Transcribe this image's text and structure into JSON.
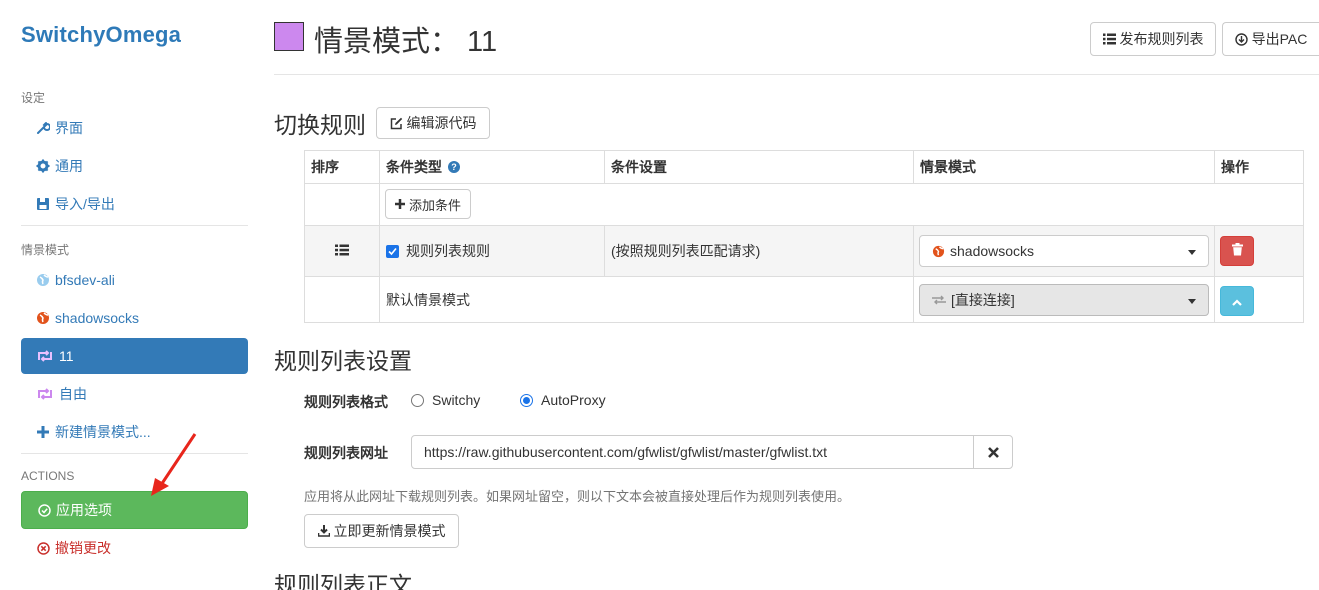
{
  "app": {
    "name": "SwitchyOmega"
  },
  "sidebar": {
    "settings_header": "设定",
    "settings_items": [
      {
        "label": "界面",
        "icon": "wrench-icon"
      },
      {
        "label": "通用",
        "icon": "gear-icon"
      },
      {
        "label": "导入/导出",
        "icon": "floppy-icon"
      }
    ],
    "profiles_header": "情景模式",
    "profiles": [
      {
        "label": "bfsdev-ali",
        "icon": "globe-icon",
        "color": "#99ccee"
      },
      {
        "label": "shadowsocks",
        "icon": "globe-icon",
        "color": "#e2531c"
      },
      {
        "label": "11",
        "icon": "switch-icon",
        "color": "#cc88ee",
        "active": true
      },
      {
        "label": "自由",
        "icon": "switch-icon",
        "color": "#cc88ee"
      }
    ],
    "new_profile": "新建情景模式...",
    "actions_header": "ACTIONS",
    "apply": "应用选项",
    "discard": "撤销更改"
  },
  "header": {
    "title": "情景模式： 11",
    "profile_color": "#cc88ee",
    "publish_button": "发布规则列表",
    "export_button": "导出PAC"
  },
  "switch_rules": {
    "title": "切换规则",
    "edit_source_button": "编辑源代码",
    "columns": [
      "排序",
      "条件类型",
      "条件设置",
      "情景模式",
      "操作"
    ],
    "add_condition_button": "添加条件",
    "rows": [
      {
        "checked": true,
        "type": "规则列表规则",
        "setting": "(按照规则列表匹配请求)",
        "profile": "shadowsocks"
      }
    ],
    "default_row": {
      "label": "默认情景模式",
      "profile": "[直接连接]"
    }
  },
  "rule_list_settings": {
    "title": "规则列表设置",
    "format_label": "规则列表格式",
    "format_options": [
      "Switchy",
      "AutoProxy"
    ],
    "format_selected": "AutoProxy",
    "url_label": "规则列表网址",
    "url_value": "https://raw.githubusercontent.com/gfwlist/gfwlist/master/gfwlist.txt",
    "help_text": "应用将从此网址下载规则列表。如果网址留空，则以下文本会被直接处理后作为规则列表使用。",
    "update_button": "立即更新情景模式"
  },
  "rule_list_text": {
    "title": "规则列表正文"
  },
  "colors": {
    "primary": "#337ab7",
    "success": "#5cb85c",
    "danger": "#d9534f",
    "info": "#5bc0de"
  }
}
